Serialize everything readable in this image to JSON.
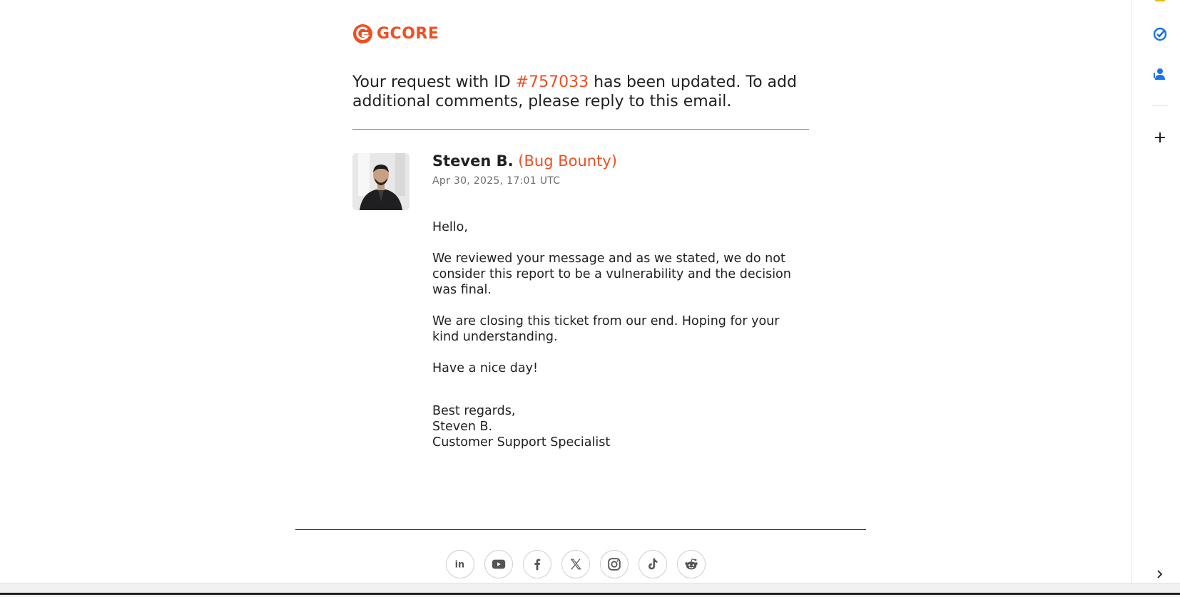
{
  "brand": {
    "logo_text": "GCORE",
    "accent_color": "#f04e23"
  },
  "intro": {
    "prefix": "Your request with ID ",
    "ticket_id": "#757033",
    "suffix": " has been updated. To add additional comments, please reply to this email."
  },
  "message": {
    "author_name": "Steven B.",
    "author_role": "(Bug Bounty)",
    "date": "Apr 30, 2025, 17:01 UTC",
    "paragraphs": [
      "Hello,",
      "We reviewed your message and as we stated, we do not consider this report to be a vulnerability and the decision was final.",
      "We are closing this ticket from our end. Hoping for your kind understanding.",
      "Have a nice day!"
    ],
    "signature": [
      "Best regards,",
      "Steven B.",
      "Customer Support Specialist"
    ]
  },
  "footer": {
    "socials": [
      "linkedin-icon",
      "youtube-icon",
      "facebook-icon",
      "x-icon",
      "instagram-icon",
      "tiktok-icon",
      "reddit-icon"
    ]
  },
  "side_panel": {
    "icons": [
      "keep-icon",
      "tasks-icon",
      "contacts-icon",
      "add-icon",
      "expand-icon"
    ]
  }
}
